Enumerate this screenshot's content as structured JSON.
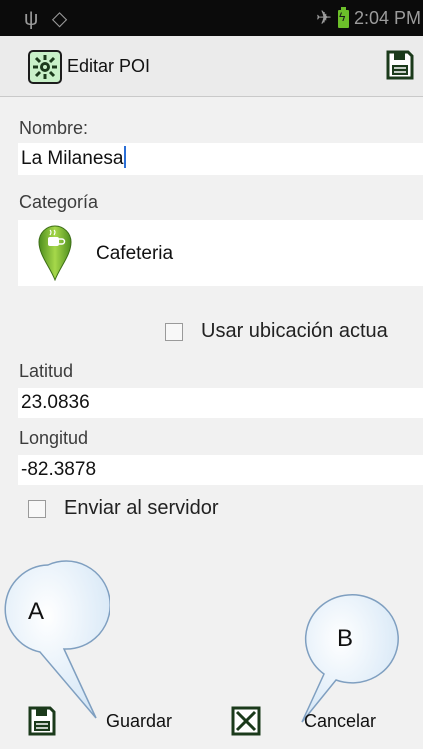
{
  "status_bar": {
    "left_icons": "usb-icon gps-icon",
    "time": "2:04 PM"
  },
  "action_bar": {
    "title": "Editar POI",
    "save_icon": "save-icon"
  },
  "form": {
    "nombre_label": "Nombre:",
    "nombre_value": "La Milanesa",
    "categoria_label": "Categoría",
    "categoria_value": "Cafeteria",
    "usar_ubicacion_label": "Usar ubicación actua",
    "usar_ubicacion_checked": false,
    "latitud_label": "Latitud",
    "latitud_value": "23.0836",
    "longitud_label": "Longitud",
    "longitud_value": "-82.3878",
    "enviar_label": "Enviar al servidor",
    "enviar_checked": false
  },
  "callouts": {
    "a": "A",
    "b": "B"
  },
  "bottom_bar": {
    "guardar_label": "Guardar",
    "cancelar_label": "Cancelar"
  },
  "colors": {
    "statusbar": "#0b0b0b",
    "battery": "#6cbf2a",
    "caret": "#2b6fd6",
    "pin_green": "#8cc63f",
    "icon_dark": "#1b3a1b"
  }
}
